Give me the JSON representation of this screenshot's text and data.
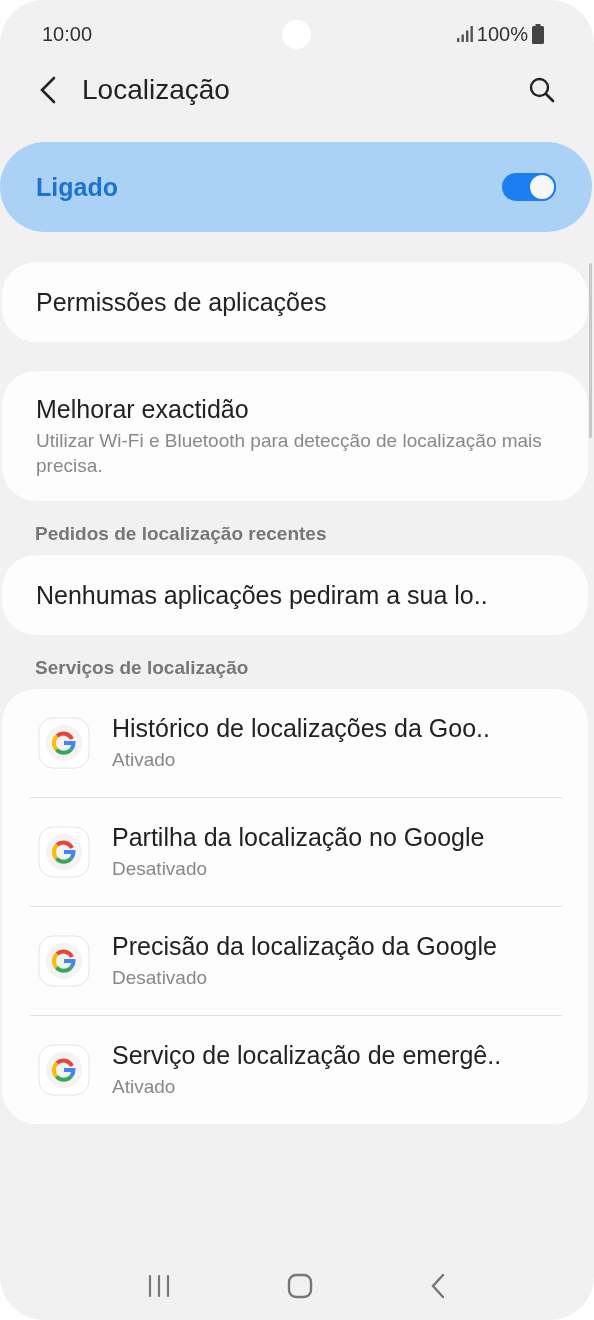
{
  "status_bar": {
    "time": "10:00",
    "battery": "100%"
  },
  "header": {
    "title": "Localização"
  },
  "master_switch": {
    "label": "Ligado",
    "on": true
  },
  "groups": [
    {
      "items": [
        {
          "title": "Permissões de aplicações"
        }
      ]
    },
    {
      "items": [
        {
          "title": "Melhorar exactidão",
          "subtitle": "Utilizar Wi-Fi e Bluetooth para detecção de localização mais precisa."
        }
      ]
    },
    {
      "heading": "Pedidos de localização recentes",
      "items": [
        {
          "title": "Nenhumas aplicações pediram a sua lo.."
        }
      ]
    },
    {
      "heading": "Serviços de localização",
      "items": [
        {
          "kind": "app",
          "title": "Histórico de localizações da Goo..",
          "subtitle": "Ativado"
        },
        {
          "kind": "app",
          "title": "Partilha da localização no Google",
          "subtitle": "Desativado"
        },
        {
          "kind": "app",
          "title": "Precisão da localização da Google",
          "subtitle": "Desativado"
        },
        {
          "kind": "app",
          "title": "Serviço de localização de emergê..",
          "subtitle": "Ativado"
        }
      ]
    }
  ]
}
